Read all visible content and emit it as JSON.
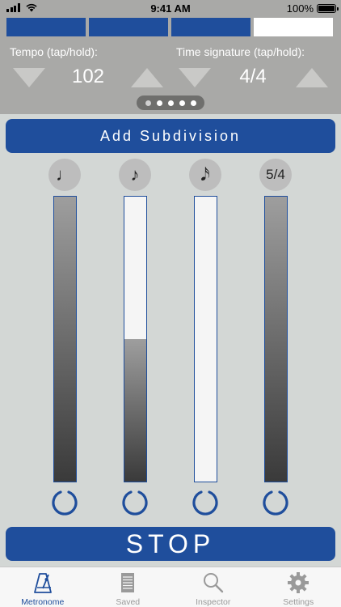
{
  "status_bar": {
    "time": "9:41 AM",
    "battery": "100%"
  },
  "beats": [
    {
      "state": "off"
    },
    {
      "state": "off"
    },
    {
      "state": "off"
    },
    {
      "state": "on"
    }
  ],
  "tempo": {
    "label": "Tempo (tap/hold):",
    "value": "102"
  },
  "time_signature": {
    "label": "Time signature (tap/hold):",
    "value": "4/4"
  },
  "pager": {
    "pages": 5,
    "current": 0
  },
  "add_subdivision_label": "Add Subdivision",
  "subdivisions": [
    {
      "symbol": "♩",
      "icon": "quarter-note-icon",
      "level": 1.0
    },
    {
      "symbol": "♪",
      "icon": "eighth-note-icon",
      "level": 0.5
    },
    {
      "symbol": "𝅘𝅥𝅯",
      "icon": "sixteenth-note-icon",
      "level": 0.0
    },
    {
      "symbol": "5/4",
      "icon": "quintuplet-icon",
      "level": 1.0
    }
  ],
  "stop_label": "STOP",
  "tabs": [
    {
      "label": "Metronome",
      "icon": "metronome-icon",
      "active": true
    },
    {
      "label": "Saved",
      "icon": "notepad-icon",
      "active": false
    },
    {
      "label": "Inspector",
      "icon": "magnifier-icon",
      "active": false
    },
    {
      "label": "Settings",
      "icon": "gear-icon",
      "active": false
    }
  ],
  "colors": {
    "accent": "#1f4e9c",
    "panel": "#a9a9a7",
    "background": "#d3d7d5"
  }
}
